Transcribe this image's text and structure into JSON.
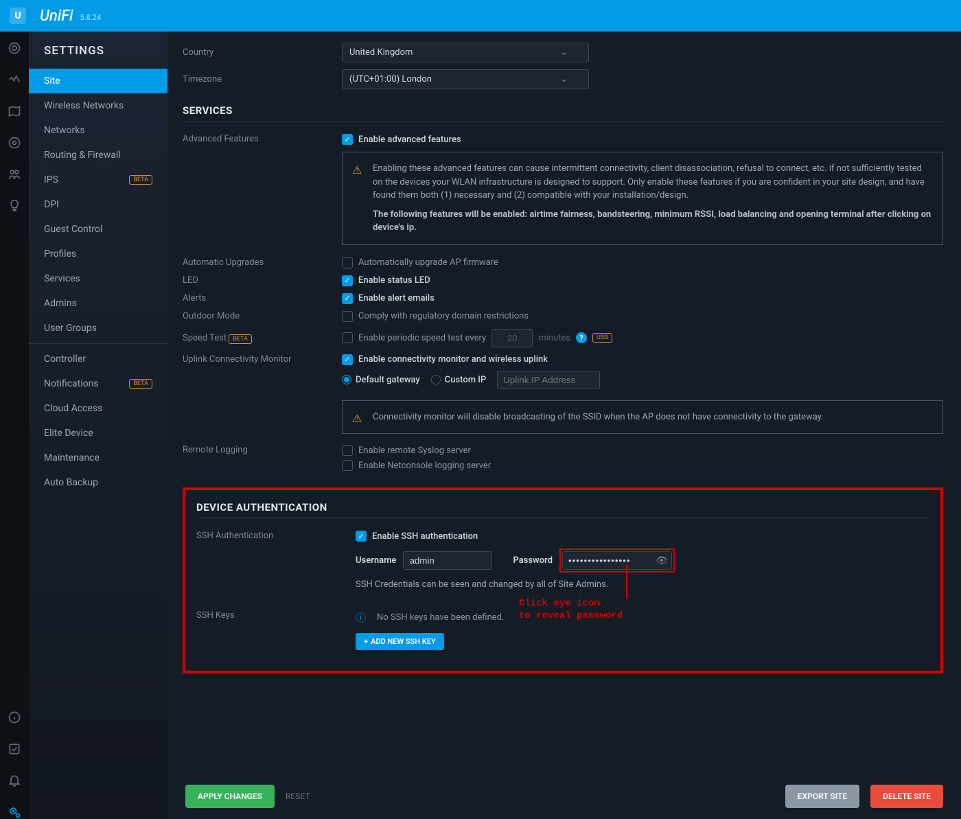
{
  "brand": "UniFi",
  "version": "5.8.24",
  "settings_title": "SETTINGS",
  "nav": [
    {
      "label": "Site",
      "active": true
    },
    {
      "label": "Wireless Networks"
    },
    {
      "label": "Networks"
    },
    {
      "label": "Routing & Firewall"
    },
    {
      "label": "IPS",
      "beta": true
    },
    {
      "label": "DPI"
    },
    {
      "label": "Guest Control"
    },
    {
      "label": "Profiles"
    },
    {
      "label": "Services"
    },
    {
      "label": "Admins"
    },
    {
      "label": "User Groups"
    },
    {
      "divider": true
    },
    {
      "label": "Controller"
    },
    {
      "label": "Notifications",
      "beta": true
    },
    {
      "label": "Cloud Access"
    },
    {
      "label": "Elite Device"
    },
    {
      "label": "Maintenance"
    },
    {
      "label": "Auto Backup"
    }
  ],
  "country_label": "Country",
  "country_value": "United Kingdom",
  "timezone_label": "Timezone",
  "timezone_value": "(UTC+01:00) London",
  "services_heading": "SERVICES",
  "adv": {
    "label": "Advanced Features",
    "check": "Enable advanced features",
    "warn_p1": "Enabling these advanced features can cause intermittent connectivity, client disassociation, refusal to connect, etc. if not sufficiently tested on the devices your WLAN infrastructure is designed to support. Only enable these features if you are confident in your site design, and have found them both (1) necessary and (2) compatible with your installation/design.",
    "warn_p2": "The following features will be enabled: airtime fairness, bandsteering, minimum RSSI, load balancing and opening terminal after clicking on device's ip."
  },
  "auto_upg": {
    "label": "Automatic Upgrades",
    "check": "Automatically upgrade AP firmware"
  },
  "led": {
    "label": "LED",
    "check": "Enable status LED"
  },
  "alerts": {
    "label": "Alerts",
    "check": "Enable alert emails"
  },
  "outdoor": {
    "label": "Outdoor Mode",
    "check": "Comply with regulatory domain restrictions"
  },
  "speed": {
    "label": "Speed Test",
    "beta": "BETA",
    "check": "Enable periodic speed test every",
    "value": "20",
    "unit": "minutes",
    "usg": "USG"
  },
  "uplink": {
    "label": "Uplink Connectivity Monitor",
    "check": "Enable connectivity monitor and wireless uplink",
    "r1": "Default gateway",
    "r2": "Custom IP",
    "placeholder": "Uplink IP Address",
    "warn": "Connectivity monitor will disable broadcasting of the SSID when the AP does not have connectivity to the gateway."
  },
  "remote": {
    "label": "Remote Logging",
    "c1": "Enable remote Syslog server",
    "c2": "Enable Netconsole logging server"
  },
  "auth_heading": "DEVICE AUTHENTICATION",
  "ssh": {
    "label": "SSH Authentication",
    "check": "Enable SSH authentication",
    "user_label": "Username",
    "user_value": "admin",
    "pwd_label": "Password",
    "pwd_value": "••••••••••••••••",
    "note": "SSH Credentials can be seen and changed by all of Site Admins."
  },
  "keys": {
    "label": "SSH Keys",
    "empty": "No SSH keys have been defined.",
    "btn": "ADD NEW SSH KEY"
  },
  "annotation": {
    "l1": "Click eye icon",
    "l2": "to reveal password"
  },
  "footer": {
    "apply": "APPLY CHANGES",
    "reset": "RESET",
    "export": "EXPORT SITE",
    "delete": "DELETE SITE"
  },
  "beta_tag": "BETA"
}
